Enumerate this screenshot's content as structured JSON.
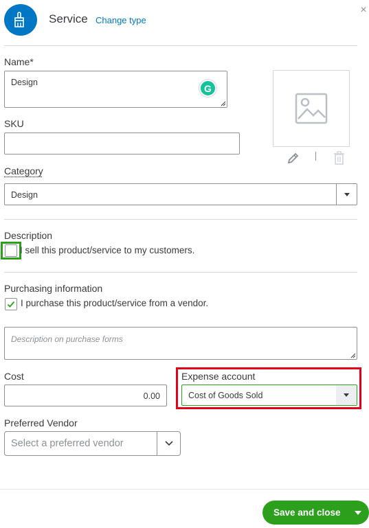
{
  "header": {
    "type_title": "Service",
    "change_type_link": "Change type",
    "close_glyph": "×",
    "type_icon": "paintbrush-icon"
  },
  "form": {
    "name_label": "Name*",
    "name_value": "Design",
    "sku_label": "SKU",
    "sku_value": "",
    "category_label": "Category",
    "category_value": "Design",
    "description_label": "Description",
    "sell_checkbox_label": "I sell this product/service to my customers.",
    "sell_checked": false,
    "purchasing_label": "Purchasing information",
    "purchase_checkbox_label": "I purchase this product/service from a vendor.",
    "purchase_checked": true,
    "purchase_description_placeholder": "Description on purchase forms",
    "cost_label": "Cost",
    "cost_value": "0.00",
    "expense_account_label": "Expense account",
    "expense_account_value": "Cost of Goods Sold",
    "preferred_vendor_label": "Preferred Vendor",
    "preferred_vendor_placeholder": "Select a preferred vendor"
  },
  "image": {
    "placeholder_icon": "image-placeholder-icon",
    "edit_icon": "pencil-icon",
    "delete_icon": "trash-icon"
  },
  "footer": {
    "save_label": "Save and close"
  },
  "colors": {
    "brand_blue": "#0077c5",
    "brand_green": "#2ca01c",
    "highlight_red": "#e0001a",
    "grammarly_green": "#15c39a"
  }
}
